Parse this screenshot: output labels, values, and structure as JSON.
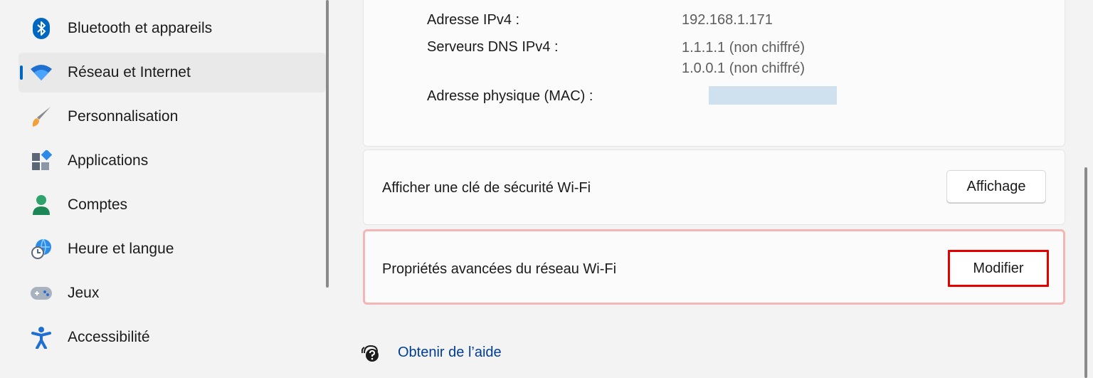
{
  "sidebar": {
    "items": [
      {
        "label": "Bluetooth et appareils",
        "icon": "bluetooth-icon"
      },
      {
        "label": "Réseau et Internet",
        "icon": "wifi-icon",
        "active": true
      },
      {
        "label": "Personnalisation",
        "icon": "paintbrush-icon"
      },
      {
        "label": "Applications",
        "icon": "apps-icon"
      },
      {
        "label": "Comptes",
        "icon": "account-icon"
      },
      {
        "label": "Heure et langue",
        "icon": "time-language-icon"
      },
      {
        "label": "Jeux",
        "icon": "gamepad-icon"
      },
      {
        "label": "Accessibilité",
        "icon": "accessibility-icon"
      }
    ]
  },
  "details": {
    "ipv4_label": "Adresse IPv4 :",
    "ipv4_value": "192.168.1.171",
    "dns_label": "Serveurs DNS IPv4 :",
    "dns_value_1": "1.1.1.1 (non chiffré)",
    "dns_value_2": "1.0.0.1 (non chiffré)",
    "mac_label": "Adresse physique (MAC) :"
  },
  "security_key": {
    "label": "Afficher une clé de sécurité Wi-Fi",
    "button": "Affichage"
  },
  "advanced": {
    "label": "Propriétés avancées du réseau Wi-Fi",
    "button": "Modifier"
  },
  "help": {
    "label": "Obtenir de l’aide",
    "icon": "help-chat-icon"
  },
  "colors": {
    "accent": "#0067c0",
    "highlight_border": "#e50000",
    "highlight_card_border": "#f4b5b5",
    "link": "#003e92"
  }
}
